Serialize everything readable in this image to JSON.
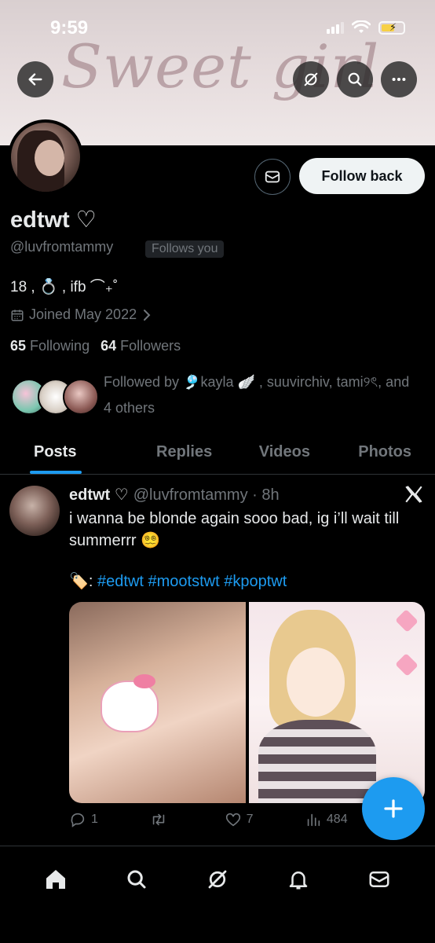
{
  "status_bar": {
    "time": "9:59"
  },
  "banner": {
    "script_text": "Sweet girl"
  },
  "profile": {
    "display_name": "edtwt ♡",
    "handle": "@luvfromtammy",
    "follows_you": "Follows you",
    "follow_back_label": "Follow back",
    "bio": "18 , 💍 , ifb ⌒₊˚",
    "joined": "Joined May 2022",
    "following_count": "65",
    "following_label": "Following",
    "followers_count": "64",
    "followers_label": "Followers",
    "followed_by": "Followed by 🎐kayla 🪽 , suuvirchiv, tami୨ৎ, and 4 others"
  },
  "tabs": [
    {
      "label": "Posts"
    },
    {
      "label": "Replies"
    },
    {
      "label": "Videos"
    },
    {
      "label": "Photos"
    }
  ],
  "post": {
    "author": "edtwt ♡",
    "meta": "@luvfromtammy · 8h",
    "text": "i wanna be blonde again sooo bad, ig i’ll wait till summerrr 😵‍💫",
    "tag_prefix": "🏷️:",
    "tags": "#edtwt #mootstwt #kpoptwt",
    "replies": "1",
    "reposts": "",
    "likes": "7",
    "views": "484"
  },
  "icons": {
    "back": "arrow-left-icon",
    "hide": "eye-off-icon",
    "search": "search-icon",
    "more": "more-horizontal-icon",
    "message": "mail-icon",
    "calendar": "calendar-icon",
    "x_logo": "x-logo-icon",
    "compose": "plus-icon",
    "nav": [
      "home-icon",
      "search-icon",
      "grok-icon",
      "bell-icon",
      "mail-icon"
    ]
  },
  "colors": {
    "accent": "#1d9bf0",
    "background": "#000000",
    "muted": "#71767b"
  }
}
